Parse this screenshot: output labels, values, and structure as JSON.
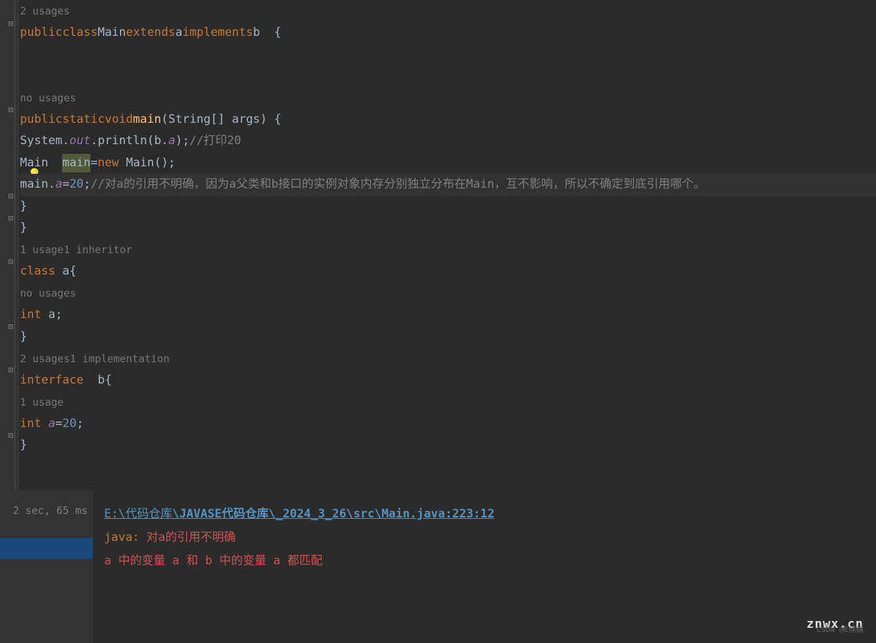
{
  "code": {
    "line0_hint": "2 usages",
    "line1": {
      "kw1": "public",
      "kw2": "class",
      "name": "Main",
      "kw3": "extends",
      "ext": "a",
      "kw4": "implements",
      "impl": "b",
      "brace": "  {"
    },
    "line4_hint": "no usages",
    "line5": {
      "kw1": "public",
      "kw2": "static",
      "kw3": "void",
      "method": "main",
      "params": "(String[] args) {"
    },
    "line6": {
      "prefix": "System.",
      "out": "out",
      "println": ".println(b.",
      "a": "a",
      "suffix": ");",
      "comment": "//打印20"
    },
    "line7": {
      "type": "Main  ",
      "var": "main",
      "eq": "=",
      "kw": "new",
      "call": " Main();"
    },
    "line8": {
      "obj": "main.",
      "field": "a",
      "eq": "=",
      "val": "20",
      "semi": ";",
      "comment": "//对a的引用不明确，因为a父类和b接口的实例对象内存分别独立分布在",
      "main": "Main",
      "comment2": "，互不影响，所以不确定到底引用哪个。"
    },
    "line9": "}",
    "line10": "}",
    "line11_hint1": "1 usage",
    "line11_hint2": "1 inheritor",
    "line12": {
      "kw": "class",
      "rest": " a{"
    },
    "line13_hint": "no usages",
    "line14": {
      "kw": "int",
      "name": " a;"
    },
    "line15": "}",
    "line16_hint1": "2 usages",
    "line16_hint2": "1 implementation",
    "line17": {
      "kw": "interface",
      "rest": "  b{"
    },
    "line18_hint": "1 usage",
    "line19": {
      "kw": "int",
      "name": " ",
      "var": "a",
      "eq": "=",
      "val": "20",
      "semi": ";"
    },
    "line20": "}"
  },
  "error": {
    "time": "2 sec, 65 ms",
    "link_prefix": "E:\\代码仓库",
    "link_mid": "\\JAVASE代码仓库",
    "link_suffix": "\\_2024_3_26\\src\\Main.java:223:12",
    "java_label": "java:",
    "msg1": " 对a的引用不明确",
    "msg2_1": "  a ",
    "msg2_2": "中的变量 ",
    "msg2_3": "a ",
    "msg2_4": "和 ",
    "msg2_5": "b ",
    "msg2_6": "中的变量 ",
    "msg2_7": "a ",
    "msg2_8": "都匹配"
  },
  "watermark": "znwx.cn",
  "watermark2": "CSDN @E绵绵"
}
